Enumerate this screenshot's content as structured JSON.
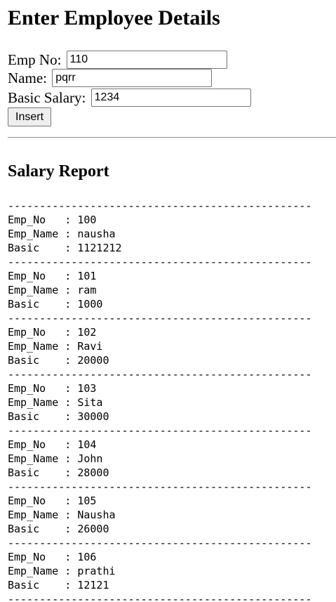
{
  "page_title": "Enter Employee Details",
  "form": {
    "emp_no_label": "Emp No:",
    "emp_no_value": "110",
    "name_label": "Name:",
    "name_value": "pqrr",
    "basic_label": "Basic Salary:",
    "basic_value": "1234",
    "insert_label": "Insert"
  },
  "report": {
    "heading": "Salary Report",
    "separator": "------------------------------------------------",
    "field_labels": {
      "emp_no": "Emp_No   ",
      "emp_name": "Emp_Name ",
      "basic": "Basic    "
    },
    "records": [
      {
        "emp_no": "100",
        "emp_name": "nausha",
        "basic": "1121212"
      },
      {
        "emp_no": "101",
        "emp_name": "ram",
        "basic": "1000"
      },
      {
        "emp_no": "102",
        "emp_name": "Ravi",
        "basic": "20000"
      },
      {
        "emp_no": "103",
        "emp_name": "Sita",
        "basic": "30000"
      },
      {
        "emp_no": "104",
        "emp_name": "John",
        "basic": "28000"
      },
      {
        "emp_no": "105",
        "emp_name": "Nausha",
        "basic": "26000"
      },
      {
        "emp_no": "106",
        "emp_name": "prathi",
        "basic": "12121"
      }
    ]
  }
}
